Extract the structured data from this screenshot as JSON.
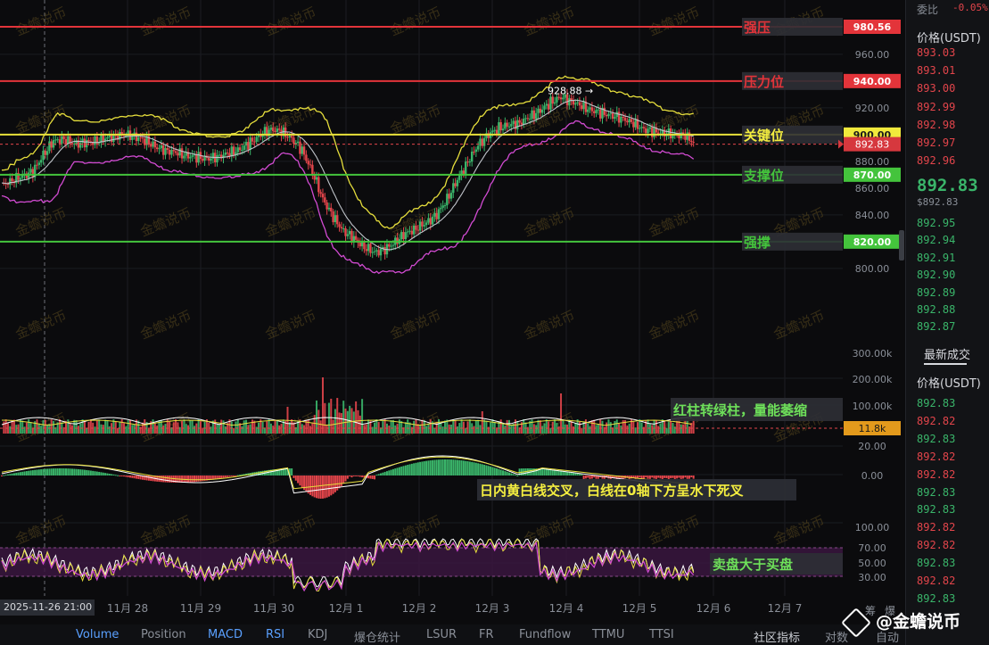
{
  "chart_data": {
    "type": "candlestick",
    "y_range": [
      790,
      985
    ],
    "levels": [
      {
        "label": "强压",
        "value": 980.56,
        "value_label": "980.56",
        "color": "#e3343a"
      },
      {
        "label": "压力位",
        "value": 940.0,
        "value_label": "940.00",
        "color": "#e3343a"
      },
      {
        "label": "关键位",
        "value": 900.0,
        "value_label": "900.00",
        "color": "#e8e23a"
      },
      {
        "label": "支撑位",
        "value": 870.0,
        "value_label": "870.00",
        "color": "#44c43c"
      },
      {
        "label": "强撑",
        "value": 820.0,
        "value_label": "820.00",
        "color": "#44c43c"
      }
    ],
    "current_price": {
      "value": 892.83,
      "label": "892.83"
    },
    "peak_annotation": {
      "value": 928.88,
      "label": "928.88 →"
    },
    "price_axis_ticks": [
      {
        "v": 960,
        "t": "960.00"
      },
      {
        "v": 920,
        "t": "920.00"
      },
      {
        "v": 880,
        "t": "880.00"
      },
      {
        "v": 860,
        "t": "860.00"
      },
      {
        "v": 840,
        "t": "840.00"
      },
      {
        "v": 800,
        "t": "800.00"
      }
    ],
    "price_series": [
      862,
      866,
      869,
      872,
      885,
      895,
      897,
      893,
      894,
      895,
      897,
      899,
      900,
      898,
      895,
      890,
      888,
      886,
      884,
      883,
      882,
      884,
      886,
      889,
      894,
      900,
      904,
      902,
      897,
      888,
      872,
      852,
      838,
      828,
      822,
      816,
      812,
      814,
      820,
      826,
      830,
      834,
      840,
      852,
      866,
      880,
      892,
      900,
      905,
      907,
      909,
      913,
      918,
      924,
      928,
      925,
      921,
      918,
      916,
      914,
      912,
      908,
      904,
      902,
      901,
      900,
      899,
      893
    ],
    "volume_axis_ticks": [
      "300.00k",
      "200.00k",
      "100.00k"
    ],
    "volume_current_label": "11.8k",
    "macd_axis_ticks": [
      "20.00",
      "0.00"
    ],
    "rsi_axis_ticks": [
      "100.00",
      "70.00",
      "50.00",
      "30.00"
    ],
    "annotations": {
      "volume": "红柱转绿柱，量能萎缩",
      "macd": "日内黄白线交叉，白线在0轴下方呈水下死叉",
      "rsi": "卖盘大于买盘"
    },
    "x_labels": [
      "2025-11-26 21:00",
      "11月 28",
      "11月 29",
      "11月 30",
      "12月 1",
      "12月 2",
      "12月 3",
      "12月 4",
      "12月 5",
      "12月 6",
      "12月 7"
    ]
  },
  "right_panel": {
    "committee_label": "委比",
    "committee_value": "-0.05%",
    "price_header": "价格(USDT)",
    "asks": [
      "893.03",
      "893.01",
      "893.00",
      "892.99",
      "892.98",
      "892.97",
      "892.96"
    ],
    "last_price": "892.83",
    "last_price_sub": "$892.83",
    "bids": [
      "892.95",
      "892.94",
      "892.91",
      "892.90",
      "892.89",
      "892.88",
      "892.87"
    ],
    "trades_title": "最新成交",
    "trades_header": "价格(USDT)",
    "trades": [
      {
        "p": "892.83",
        "c": "#3ab56a"
      },
      {
        "p": "892.82",
        "c": "#e3454b"
      },
      {
        "p": "892.83",
        "c": "#3ab56a"
      },
      {
        "p": "892.82",
        "c": "#e3454b"
      },
      {
        "p": "892.82",
        "c": "#e3454b"
      },
      {
        "p": "892.83",
        "c": "#3ab56a"
      },
      {
        "p": "892.83",
        "c": "#3ab56a"
      },
      {
        "p": "892.82",
        "c": "#e3454b"
      },
      {
        "p": "892.82",
        "c": "#e3454b"
      },
      {
        "p": "892.83",
        "c": "#3ab56a"
      },
      {
        "p": "892.82",
        "c": "#e3454b"
      },
      {
        "p": "892.83",
        "c": "#3ab56a"
      }
    ]
  },
  "bottom_tabs": [
    "Volume",
    "Position",
    "MACD",
    "RSI",
    "KDJ",
    "爆仓统计",
    "LSUR",
    "FR",
    "Fundflow",
    "TTMU",
    "TTSI"
  ],
  "bottom_right": {
    "community": "社区指标",
    "log": "对数",
    "auto": "自动",
    "log_short": "筹",
    "auto_short": "爆"
  },
  "watermark": "金蟾说币",
  "brand": "@金蟾说币",
  "colors": {
    "up": "#3ab56a",
    "down": "#e3454b",
    "bg": "#0b0b0d"
  }
}
